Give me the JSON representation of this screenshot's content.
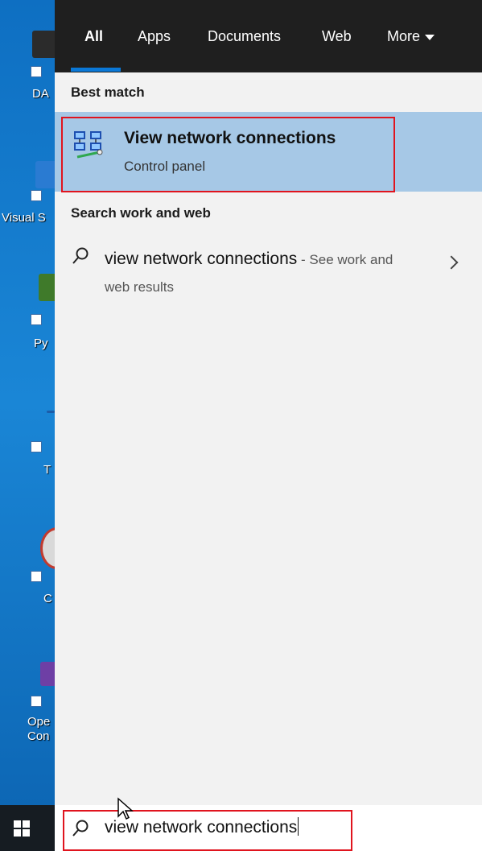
{
  "desktop": {
    "icons": [
      {
        "label": "DA",
        "color": "#2b2b2b"
      },
      {
        "label": "Visual S",
        "color": "#2a7bd2"
      },
      {
        "label": "Py",
        "color": "#3f7a2a"
      },
      {
        "label": "T",
        "color": "#1c5ca8"
      },
      {
        "label": "C",
        "color": "#d9d9d9"
      },
      {
        "label": "Ope\nCon",
        "color": "#6e3fa5"
      }
    ]
  },
  "search_panel": {
    "tabs": [
      {
        "label": "All",
        "selected": true
      },
      {
        "label": "Apps"
      },
      {
        "label": "Documents"
      },
      {
        "label": "Web"
      },
      {
        "label": "More"
      }
    ],
    "best_match_header": "Best match",
    "best_match": {
      "title": "View network connections",
      "subtitle": "Control panel",
      "icon": "network-connections-icon"
    },
    "web_header": "Search work and web",
    "web_result": {
      "query": "view network connections",
      "hint": " - See work and web results",
      "icon": "search-icon"
    }
  },
  "taskbar": {
    "search_value": "view network connections",
    "start_icon": "windows-logo-icon"
  },
  "colors": {
    "accent": "#0a78d7",
    "highlight_border": "#e0141e",
    "selected_row": "#a6c8e6"
  }
}
